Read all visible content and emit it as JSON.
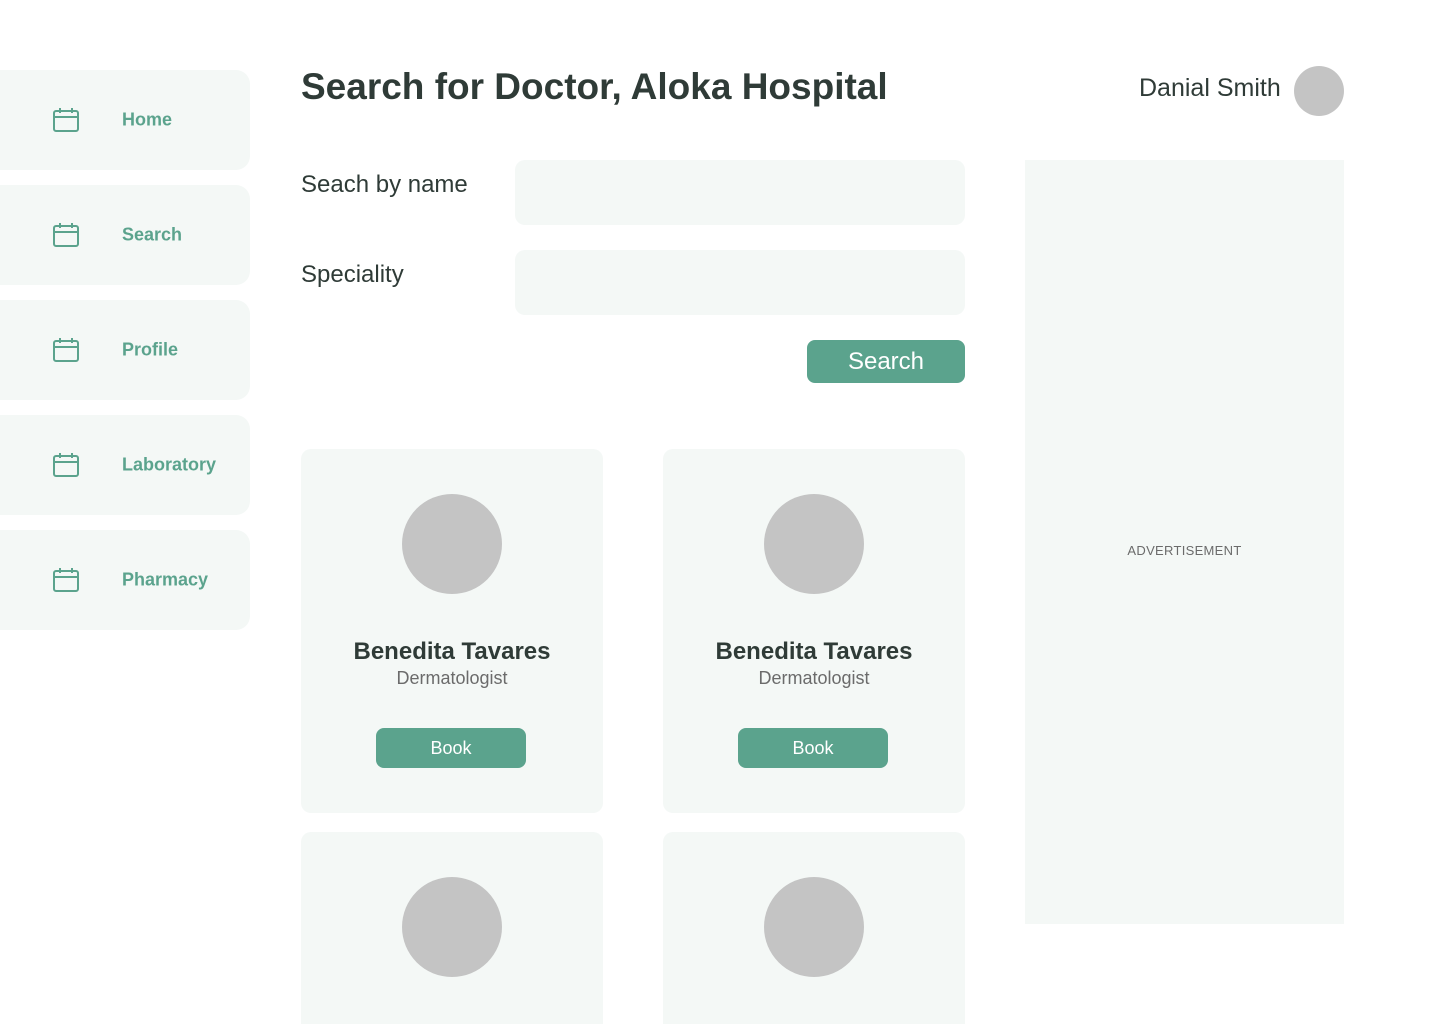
{
  "sidebar": {
    "items": [
      {
        "label": "Home",
        "icon": "calendar-icon"
      },
      {
        "label": "Search",
        "icon": "calendar-icon"
      },
      {
        "label": "Profile",
        "icon": "calendar-icon"
      },
      {
        "label": "Laboratory",
        "icon": "calendar-icon"
      },
      {
        "label": "Pharmacy",
        "icon": "calendar-icon"
      }
    ]
  },
  "header": {
    "title_prefix": "Search for Doctor, ",
    "hospital_name": "Aloka Hospital",
    "user_name": "Danial Smith"
  },
  "search_form": {
    "name_label": "Seach by name",
    "name_value": "",
    "speciality_label": "Speciality",
    "speciality_value": "",
    "search_button": "Search"
  },
  "doctors": [
    {
      "name": "Benedita Tavares",
      "speciality": "Dermatologist",
      "book_label": "Book"
    },
    {
      "name": "Benedita Tavares",
      "speciality": "Dermatologist",
      "book_label": "Book"
    },
    {
      "name": "",
      "speciality": "",
      "book_label": ""
    },
    {
      "name": "",
      "speciality": "",
      "book_label": ""
    }
  ],
  "advertisement": {
    "label": "ADVERTISEMENT"
  },
  "colors": {
    "accent": "#5ba38d",
    "panel": "#f4f8f6",
    "placeholder_gray": "#c4c4c4",
    "text_dark": "#2f3b37"
  }
}
